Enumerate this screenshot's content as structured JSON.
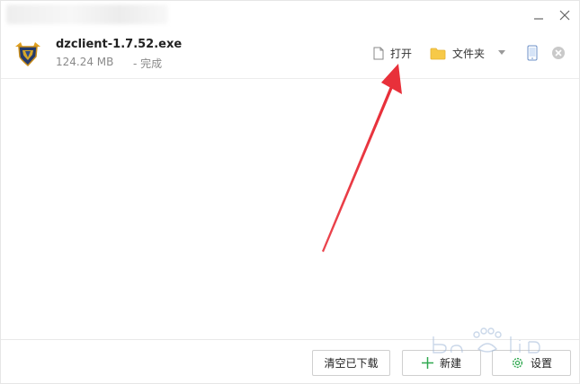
{
  "window": {
    "title": ""
  },
  "download": {
    "file_name": "dzclient-1.7.52.exe",
    "file_size": "124.24 MB",
    "status": "- 完成",
    "open_label": "打开",
    "folder_label": "文件夹",
    "icon": "game-shield-icon"
  },
  "footer": {
    "clear_label": "清空已下载",
    "new_label": "新建",
    "settings_label": "设置"
  },
  "colors": {
    "accent_green": "#2fa84f",
    "folder_yellow": "#f7c948",
    "arrow_red": "#e8303a"
  }
}
